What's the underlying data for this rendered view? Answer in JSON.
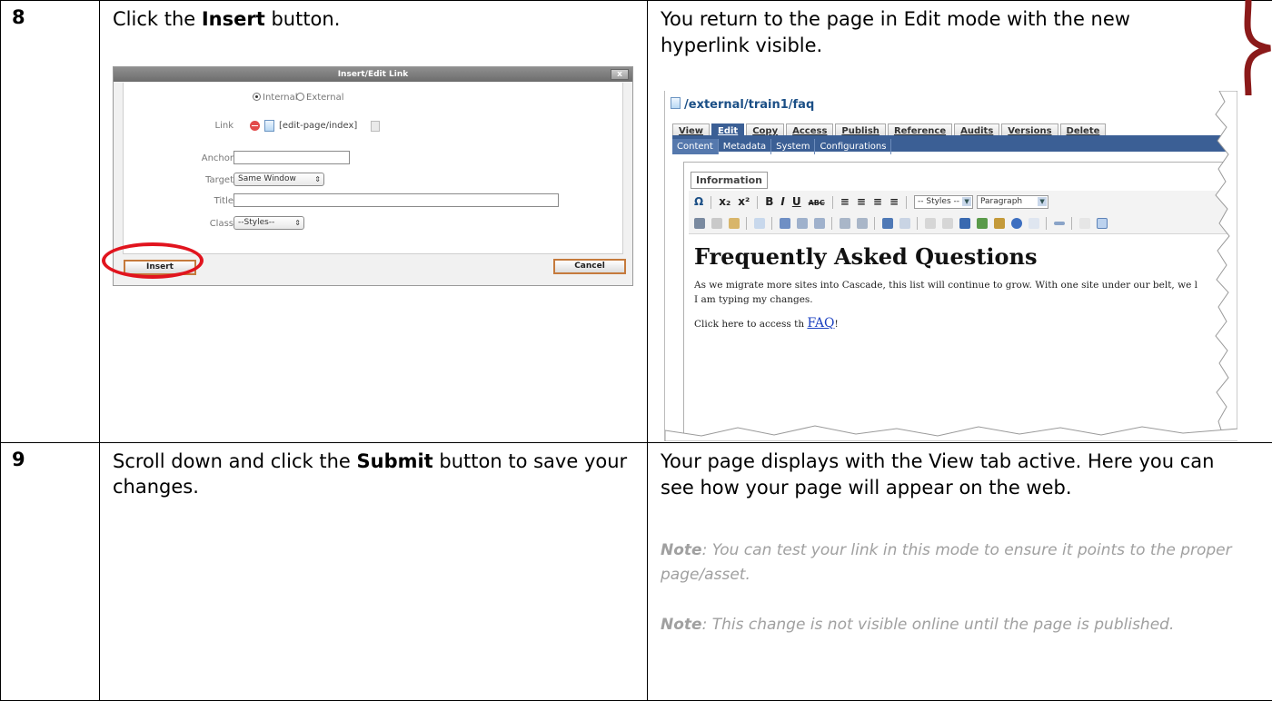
{
  "rows": [
    {
      "step": "8",
      "instruction": {
        "pre": "Click the ",
        "bold": "Insert",
        "post": " button."
      },
      "result": "You return to the page in Edit mode with the new hyperlink visible."
    },
    {
      "step": "9",
      "instruction": {
        "pre": "Scroll down and click the ",
        "bold": "Submit",
        "post": " button to save your changes."
      },
      "result": "Your page displays with the View tab active.  Here you can see how your page will appear on the web.",
      "notes": [
        {
          "label": "Note",
          "text": ": You can test your link in this mode to ensure it points to the proper page/asset."
        },
        {
          "label": "Note",
          "text": ": This change is not visible online until the page is published."
        }
      ]
    }
  ],
  "dialog": {
    "title": "Insert/Edit Link",
    "close": "x",
    "radio_internal": "Internal",
    "radio_external": "External",
    "link_label": "Link",
    "link_value": "[edit-page/index]",
    "anchor_label": "Anchor",
    "target_label": "Target",
    "target_value": "Same Window",
    "title_label": "Title",
    "class_label": "Class",
    "class_value": "--Styles--",
    "insert_button": "Insert",
    "cancel_button": "Cancel"
  },
  "editor": {
    "path": "/external/train1/faq",
    "tabs": [
      "View",
      "Edit",
      "Copy",
      "Access",
      "Publish",
      "Reference",
      "Audits",
      "Versions",
      "Delete"
    ],
    "active_tab": "Edit",
    "subtabs": [
      "Content",
      "Metadata",
      "System",
      "Configurations"
    ],
    "fieldset_legend": "Information",
    "toolbar": {
      "omega": "Ω",
      "sub": "x₂",
      "sup": "x²",
      "bold": "B",
      "italic": "I",
      "underline": "U",
      "strike": "ABC",
      "styles_select": "-- Styles --",
      "format_select": "Paragraph"
    },
    "heading": "Frequently Asked Questions",
    "para1_line1": "As we migrate more sites into Cascade, this list will continue to grow.  With one site under our belt, we l",
    "para1_line2": "I am typing my changes.",
    "para2_pre": "Click here to access th ",
    "para2_link": "FAQ",
    "para2_post": "!"
  },
  "colors": {
    "highlight": "#e1141e",
    "brace": "#8b1a1a",
    "cascade_blue": "#3b5f95",
    "link_blue": "#1a3fc0",
    "note_gray": "#a0a0a0"
  }
}
